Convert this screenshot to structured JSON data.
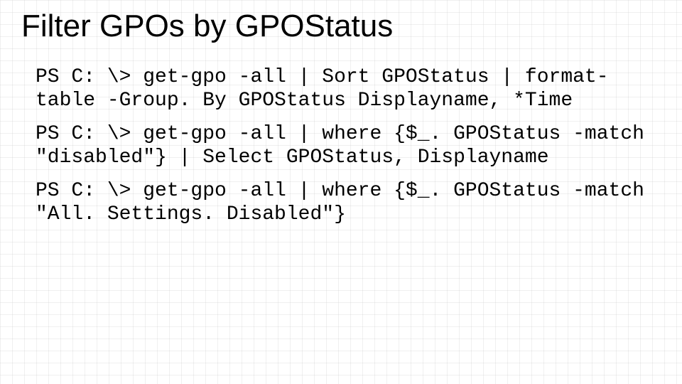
{
  "title": "Filter GPOs by GPOStatus",
  "commands": [
    "PS C: \\> get-gpo -all | Sort GPOStatus | format-table -Group. By GPOStatus Displayname, *Time",
    "PS C: \\> get-gpo -all | where {$_. GPOStatus -match \"disabled\"} | Select GPOStatus, Displayname",
    "PS C: \\> get-gpo -all | where {$_. GPOStatus -match \"All. Settings. Disabled\"}"
  ]
}
